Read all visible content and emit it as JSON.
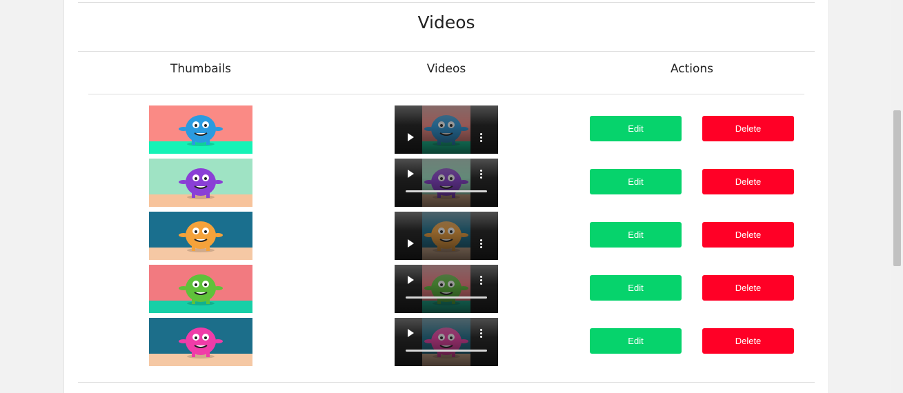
{
  "page": {
    "title": "Videos"
  },
  "table": {
    "headers": {
      "thumbnails": "Thumbails",
      "videos": "Videos",
      "actions": "Actions"
    },
    "rows": [
      {
        "thumb_bg": "#fa8a85",
        "floor": "#15f2b6",
        "monster": "#2b9be0",
        "edit_label": "Edit",
        "delete_label": "Delete",
        "has_progress": false
      },
      {
        "thumb_bg": "#9fe3c4",
        "floor": "#f7c39b",
        "monster": "#8a3fd6",
        "edit_label": "Edit",
        "delete_label": "Delete",
        "has_progress": true
      },
      {
        "thumb_bg": "#1a6f8e",
        "floor": "#f5c8a4",
        "monster": "#f5a23a",
        "edit_label": "Edit",
        "delete_label": "Delete",
        "has_progress": false
      },
      {
        "thumb_bg": "#f27a80",
        "floor": "#17cfa7",
        "monster": "#5fc23a",
        "edit_label": "Edit",
        "delete_label": "Delete",
        "has_progress": true
      },
      {
        "thumb_bg": "#1c6e8a",
        "floor": "#f5c8a4",
        "monster": "#f03ca8",
        "edit_label": "Edit",
        "delete_label": "Delete",
        "has_progress": true
      }
    ]
  },
  "colors": {
    "edit": "#06d36c",
    "delete": "#ff0026"
  }
}
